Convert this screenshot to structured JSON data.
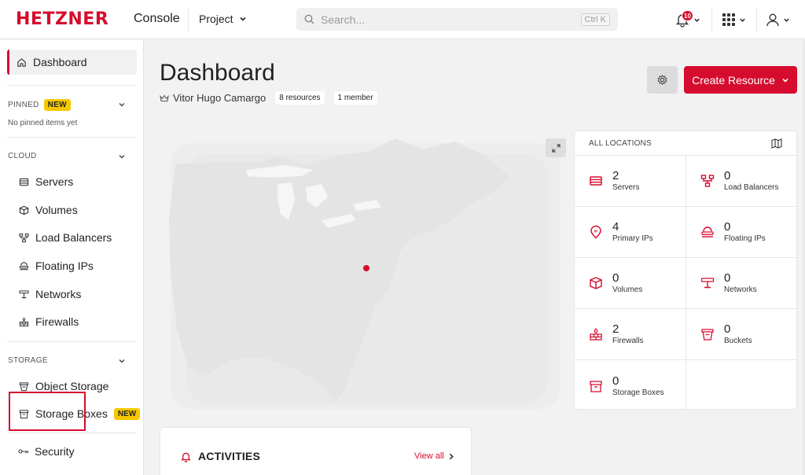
{
  "brand": {
    "logo_text": "HETZNER",
    "product": "Console",
    "accent": "#d50c2d"
  },
  "header": {
    "project_label": "Project",
    "search_placeholder": "Search...",
    "search_shortcut": "Ctrl K",
    "notification_count": "10",
    "icons": [
      "bell-icon",
      "apps-grid-icon",
      "user-icon"
    ]
  },
  "sidebar": {
    "dashboard_label": "Dashboard",
    "pinned": {
      "title": "PINNED",
      "badge": "NEW",
      "empty_text": "No pinned items yet"
    },
    "cloud": {
      "title": "CLOUD",
      "items": [
        {
          "label": "Servers",
          "icon": "server-icon"
        },
        {
          "label": "Volumes",
          "icon": "volume-icon"
        },
        {
          "label": "Load Balancers",
          "icon": "load-balancer-icon"
        },
        {
          "label": "Floating IPs",
          "icon": "floating-ip-icon"
        },
        {
          "label": "Networks",
          "icon": "network-icon"
        },
        {
          "label": "Firewalls",
          "icon": "firewall-icon"
        }
      ]
    },
    "storage": {
      "title": "STORAGE",
      "items": [
        {
          "label": "Object Storage",
          "icon": "bucket-icon"
        },
        {
          "label": "Storage Boxes",
          "icon": "storage-box-icon",
          "badge": "NEW"
        }
      ]
    },
    "security_label": "Security"
  },
  "main": {
    "title": "Dashboard",
    "owner": "Vitor Hugo Camargo",
    "resources_pill": "8 resources",
    "members_pill": "1 member",
    "create_button": "Create Resource"
  },
  "locations": {
    "title": "ALL LOCATIONS",
    "cells": [
      {
        "count": "2",
        "label": "Servers",
        "icon": "server-icon"
      },
      {
        "count": "0",
        "label": "Load Balancers",
        "icon": "load-balancer-icon"
      },
      {
        "count": "4",
        "label": "Primary IPs",
        "icon": "primary-ip-icon"
      },
      {
        "count": "0",
        "label": "Floating IPs",
        "icon": "floating-ip-icon"
      },
      {
        "count": "0",
        "label": "Volumes",
        "icon": "volume-icon"
      },
      {
        "count": "0",
        "label": "Networks",
        "icon": "network-icon"
      },
      {
        "count": "2",
        "label": "Firewalls",
        "icon": "firewall-icon"
      },
      {
        "count": "0",
        "label": "Buckets",
        "icon": "bucket-icon"
      },
      {
        "count": "0",
        "label": "Storage Boxes",
        "icon": "storage-box-icon"
      }
    ]
  },
  "activities": {
    "title": "ACTIVITIES",
    "view_all": "View all"
  }
}
